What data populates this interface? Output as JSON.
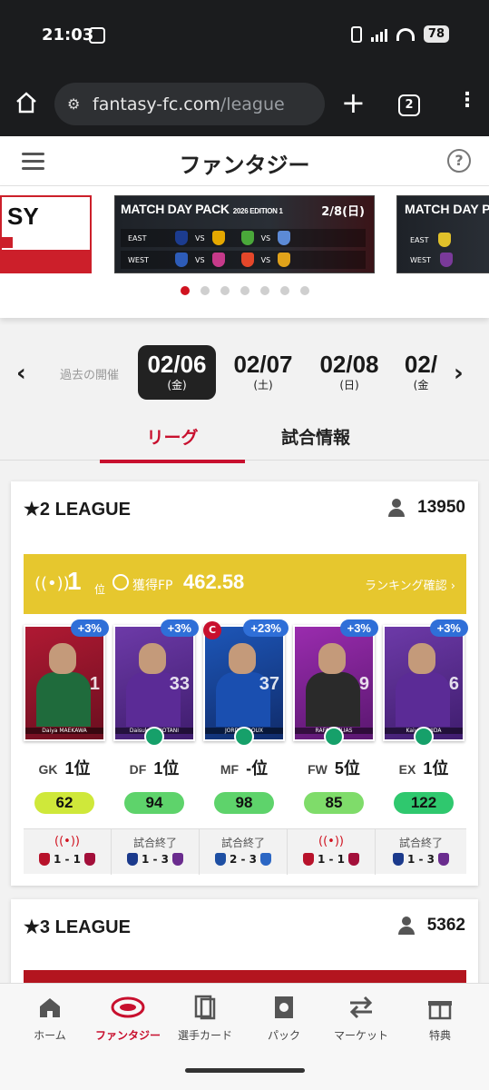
{
  "status": {
    "time": "21:03",
    "battery": "78"
  },
  "browser": {
    "url_host": "fantasy-fc.com",
    "url_path": "/league",
    "tab_count": "2"
  },
  "header": {
    "title": "ファンタジー"
  },
  "banner": {
    "left_text": "SY",
    "main_title": "MATCH DAY PACK",
    "main_edition": "2026 EDITION 1",
    "main_date": "2/8(日)",
    "east_label": "EAST",
    "west_label": "WEST",
    "vs": "VS",
    "right_title": "MATCH DAY PACK",
    "dots": 7,
    "active_dot": 0
  },
  "dates": {
    "past_label": "過去の開催",
    "items": [
      {
        "date": "02/06",
        "day": "(金)"
      },
      {
        "date": "02/07",
        "day": "(土)"
      },
      {
        "date": "02/08",
        "day": "(日)"
      },
      {
        "date": "02/",
        "day": "(金"
      }
    ]
  },
  "tabs": {
    "league": "リーグ",
    "match_info": "試合情報"
  },
  "leagues": [
    {
      "name": "★2 LEAGUE",
      "participants": "13950",
      "rank": "1",
      "rank_unit": "位",
      "fp_label": "獲得FP",
      "fp_value": "462.58",
      "ranking_link": "ランキング確認 ›",
      "players": [
        {
          "pct": "+3%",
          "name": "Daiya MAEKAWA",
          "number": "1",
          "position": "GK",
          "rank": "1位",
          "points": "62",
          "pill_color": "#cfe83a"
        },
        {
          "pct": "+3%",
          "name": "Daisuke SHIOTANI",
          "number": "33",
          "position": "DF",
          "rank": "1位",
          "points": "94",
          "pill_color": "#5ed36b"
        },
        {
          "pct": "+23%",
          "name": "JORDY CROUX",
          "number": "37",
          "position": "MF",
          "rank": "-位",
          "points": "98",
          "pill_color": "#5ed36b",
          "captain": "C"
        },
        {
          "pct": "+3%",
          "name": "RAFAEL ELIAS",
          "number": "9",
          "position": "FW",
          "rank": "5位",
          "points": "85",
          "pill_color": "#7fdc6a"
        },
        {
          "pct": "+3%",
          "name": "Kaiyu ISHIDA",
          "number": "6",
          "position": "EX",
          "rank": "1位",
          "points": "122",
          "pill_color": "#2fc86e"
        }
      ],
      "matches": [
        {
          "status": "((•))",
          "score": "1 - 1",
          "home_color": "#b8122b",
          "away_color": "#a30f3a"
        },
        {
          "status": "試合終了",
          "score": "1 - 3",
          "home_color": "#1b3a8c",
          "away_color": "#6a2c8e"
        },
        {
          "status": "試合終了",
          "score": "2 - 3",
          "home_color": "#1e4fa3",
          "away_color": "#2b66c4"
        },
        {
          "status": "((•))",
          "score": "1 - 1",
          "home_color": "#b8122b",
          "away_color": "#a30f3a"
        },
        {
          "status": "試合終了",
          "score": "1 - 3",
          "home_color": "#1b3a8c",
          "away_color": "#6a2c8e"
        }
      ]
    },
    {
      "name": "★3 LEAGUE",
      "participants": "5362"
    }
  ],
  "nav": [
    {
      "label": "ホーム",
      "icon": "home-icon"
    },
    {
      "label": "ファンタジー",
      "icon": "stadium-icon"
    },
    {
      "label": "選手カード",
      "icon": "cards-icon"
    },
    {
      "label": "パック",
      "icon": "pack-icon"
    },
    {
      "label": "マーケット",
      "icon": "transfer-icon"
    },
    {
      "label": "特典",
      "icon": "gift-icon"
    }
  ],
  "colors": {
    "accent": "#c8102e",
    "rank_bar": "#e6c72e",
    "pct_badge": "#2f6fd8"
  }
}
